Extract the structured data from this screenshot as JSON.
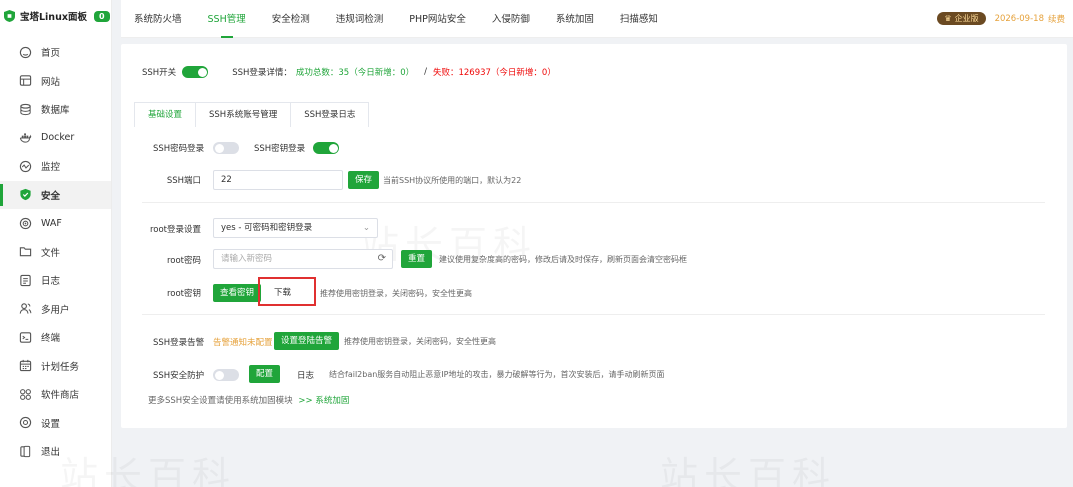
{
  "brand": {
    "name": "宝塔Linux面板",
    "badge": "0"
  },
  "sidebar": {
    "items": [
      {
        "label": "首页",
        "icon": "home-icon"
      },
      {
        "label": "网站",
        "icon": "globe-icon"
      },
      {
        "label": "数据库",
        "icon": "database-icon"
      },
      {
        "label": "Docker",
        "icon": "docker-icon"
      },
      {
        "label": "监控",
        "icon": "monitor-icon"
      },
      {
        "label": "安全",
        "icon": "shield-icon"
      },
      {
        "label": "WAF",
        "icon": "waf-icon"
      },
      {
        "label": "文件",
        "icon": "folder-icon"
      },
      {
        "label": "日志",
        "icon": "log-icon"
      },
      {
        "label": "多用户",
        "icon": "users-icon"
      },
      {
        "label": "终端",
        "icon": "terminal-icon"
      },
      {
        "label": "计划任务",
        "icon": "calendar-icon"
      },
      {
        "label": "软件商店",
        "icon": "apps-icon"
      },
      {
        "label": "设置",
        "icon": "gear-icon"
      },
      {
        "label": "退出",
        "icon": "logout-icon"
      }
    ],
    "active_index": 5
  },
  "tabs": [
    "系统防火墙",
    "SSH管理",
    "安全检测",
    "违规词检测",
    "PHP网站安全",
    "入侵防御",
    "系统加固",
    "扫描感知"
  ],
  "active_tab": 1,
  "enterprise": {
    "label": "企业版",
    "date": "2026-09-18",
    "renew": "续费"
  },
  "ssh": {
    "switch_label": "SSH开关",
    "details_label": "SSH登录详情：",
    "success_text": "成功总数：35（今日新增：0）",
    "separator": "/",
    "fail_text": "失败：126937（今日新增：0）"
  },
  "subtabs": [
    "基础设置",
    "SSH系统账号管理",
    "SSH登录日志"
  ],
  "form": {
    "password_login_label": "SSH密码登录",
    "key_login_label": "SSH密钥登录",
    "port_label": "SSH端口",
    "port_value": "22",
    "save_label": "保存",
    "port_hint": "当前SSH协议所使用的端口，默认为22",
    "root_login_label": "root登录设置",
    "root_login_value": "yes - 可密码和密钥登录",
    "root_password_label": "root密码",
    "root_password_placeholder": "请输入新密码",
    "reset_label": "重置",
    "reset_hint": "建议使用复杂度高的密码，修改后请及时保存，刷新页面会清空密码框",
    "root_key_label": "root密钥",
    "view_key_label": "查看密钥",
    "download_label": "下载",
    "key_hint": "推荐使用密钥登录，关闭密码，安全性更高",
    "alert_label": "SSH登录告警",
    "alert_status": "告警通知未配置",
    "alert_button": "设置登陆告警",
    "alert_hint": "推荐使用密钥登录，关闭密码，安全性更高",
    "protect_label": "SSH安全防护",
    "config_label": "配置",
    "log_label": "日志",
    "protect_hint": "结合fail2ban服务自动阻止恶意IP地址的攻击，暴力破解等行为，首次安装后，请手动刷新页面",
    "footer_text": "更多SSH安全设置请使用系统加固模块",
    "footer_link": ">> 系统加固"
  },
  "watermark": "站长百科",
  "colors": {
    "accent": "#20a53a",
    "danger": "#ef0808",
    "warning": "#e6a23c",
    "highlight": "#e03030"
  }
}
